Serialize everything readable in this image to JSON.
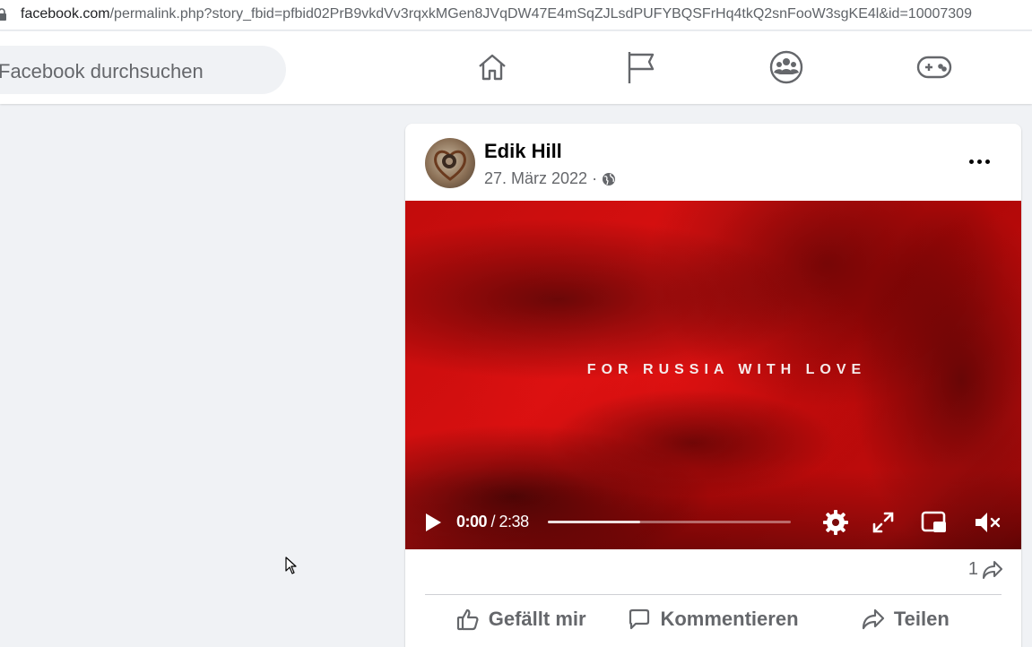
{
  "browser": {
    "url_domain": "facebook.com",
    "url_path": "/permalink.php?story_fbid=pfbid02PrB9vkdVv3rqxkMGen8JVqDW47E4mSqZJLsdPUFYBQSFrHq4tkQ2snFooW3sgKE4l&id=10007309"
  },
  "header": {
    "search_placeholder": "Facebook durchsuchen",
    "nav_icons": [
      "home-icon",
      "pages-flag-icon",
      "groups-icon",
      "gaming-icon"
    ]
  },
  "post": {
    "author": "Edik Hill",
    "date": "27. März 2022",
    "separator": "·",
    "audience_icon": "globe-icon",
    "video": {
      "overlay_text": "FOR RUSSIA WITH LOVE",
      "current_time": "0:00",
      "duration": "/ 2:38",
      "progress_buffered": 0.38,
      "controls": [
        "play-icon",
        "settings-icon",
        "fullscreen-icon",
        "picture-in-picture-icon",
        "muted-speaker-icon"
      ]
    },
    "share_count": "1",
    "actions": {
      "like": "Gefällt mir",
      "comment": "Kommentieren",
      "share": "Teilen"
    }
  },
  "colors": {
    "background": "#f0f2f5",
    "text_secondary": "#65676b",
    "video_red": "#c20c0c"
  }
}
